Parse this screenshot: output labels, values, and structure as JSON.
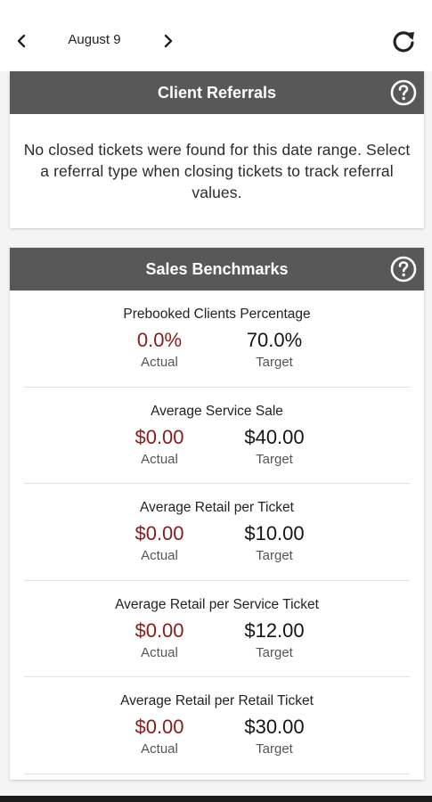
{
  "date_nav": {
    "date_label": "August 9",
    "prev_icon": "chevron-left-icon",
    "next_icon": "chevron-right-icon",
    "refresh_icon": "refresh-icon"
  },
  "client_referrals": {
    "title": "Client Referrals",
    "help_icon": "help-circle-icon",
    "message": "No closed tickets were found for this date range. Select a referral type when closing tickets to track referral values."
  },
  "sales_benchmarks": {
    "title": "Sales Benchmarks",
    "help_icon": "help-circle-icon",
    "actual_color": "#8b1a1a",
    "items": [
      {
        "title": "Prebooked Clients Percentage",
        "actual_value": "0.0%",
        "actual_label": "Actual",
        "target_value": "70.0%",
        "target_label": "Target"
      },
      {
        "title": "Average Service Sale",
        "actual_value": "$0.00",
        "actual_label": "Actual",
        "target_value": "$40.00",
        "target_label": "Target"
      },
      {
        "title": "Average Retail per Ticket",
        "actual_value": "$0.00",
        "actual_label": "Actual",
        "target_value": "$10.00",
        "target_label": "Target"
      },
      {
        "title": "Average Retail per Service Ticket",
        "actual_value": "$0.00",
        "actual_label": "Actual",
        "target_value": "$12.00",
        "target_label": "Target"
      },
      {
        "title": "Average Retail per Retail Ticket",
        "actual_value": "$0.00",
        "actual_label": "Actual",
        "target_value": "$30.00",
        "target_label": "Target"
      }
    ]
  }
}
